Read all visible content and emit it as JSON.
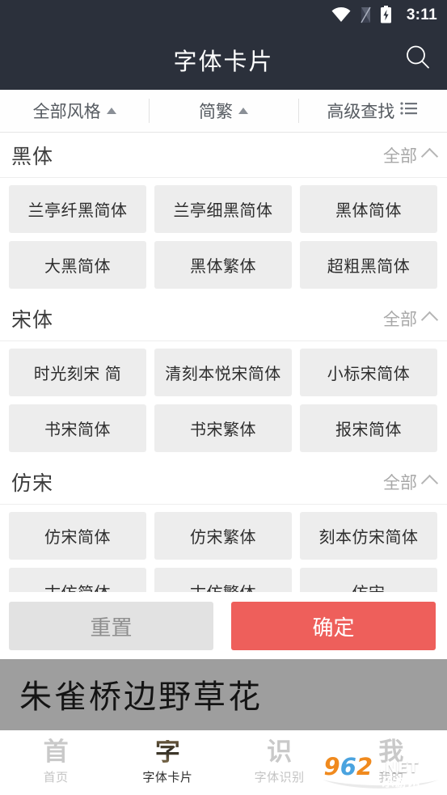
{
  "statusbar": {
    "time": "3:11",
    "icons": [
      "wifi-icon",
      "sim-card-icon",
      "battery-charging-icon"
    ]
  },
  "header": {
    "title": "字体卡片",
    "search_icon": "search-icon"
  },
  "filterbar": {
    "items": [
      {
        "label": "全部风格",
        "icon": "caret-up-icon"
      },
      {
        "label": "简繁",
        "icon": "caret-up-icon"
      },
      {
        "label": "高级查找",
        "icon": "list-icon"
      }
    ]
  },
  "sections": [
    {
      "title": "黑体",
      "all_label": "全部",
      "collapse_icon": "chevron-up-icon",
      "fonts": [
        "兰亭纤黑简体",
        "兰亭细黑简体",
        "黑体简体",
        "大黑简体",
        "黑体繁体",
        "超粗黑简体"
      ]
    },
    {
      "title": "宋体",
      "all_label": "全部",
      "collapse_icon": "chevron-up-icon",
      "fonts": [
        "时光刻宋 简",
        "清刻本悦宋简体",
        "小标宋简体",
        "书宋简体",
        "书宋繁体",
        "报宋简体"
      ]
    },
    {
      "title": "仿宋",
      "all_label": "全部",
      "collapse_icon": "chevron-up-icon",
      "fonts": [
        "仿宋简体",
        "仿宋繁体",
        "刻本仿宋简体",
        "古仿简体",
        "古仿繁体",
        "仿宋"
      ]
    }
  ],
  "actions": {
    "reset_label": "重置",
    "confirm_label": "确定",
    "confirm_color": "#ee5f5b",
    "reset_color": "#e2e2e2"
  },
  "preview": {
    "text": "朱雀桥边野草花",
    "background": "#9e9e9e"
  },
  "bottomnav": {
    "items": [
      {
        "glyph": "首",
        "label": "首页",
        "active": false
      },
      {
        "glyph": "字",
        "label": "字体卡片",
        "active": true
      },
      {
        "glyph": "识",
        "label": "字体识别",
        "active": false
      },
      {
        "glyph": "我",
        "label": "我的",
        "active": false
      }
    ]
  },
  "watermark": {
    "digits": [
      "9",
      "6",
      "2"
    ],
    "domain": ".NET",
    "chinese": "乐游网"
  }
}
